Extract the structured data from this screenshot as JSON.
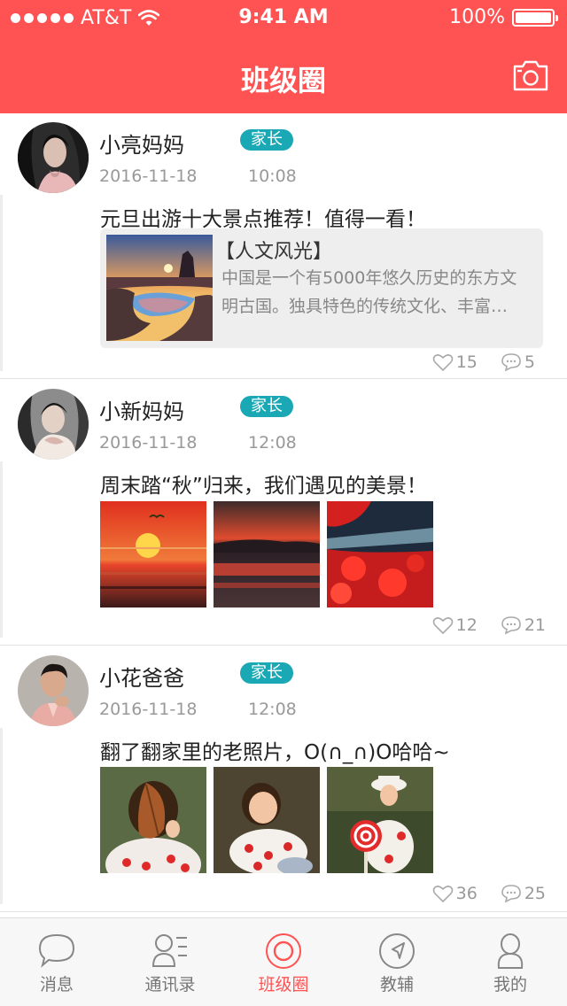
{
  "status_bar": {
    "carrier": "AT&T",
    "time": "9:41 AM",
    "battery": "100%"
  },
  "header": {
    "title": "班级圈"
  },
  "colors": {
    "accent": "#ff5353",
    "role_badge": "#1aa8b5"
  },
  "posts": [
    {
      "author": "小亮妈妈",
      "role": "家长",
      "date": "2016-11-18",
      "time": "10:08",
      "content": "元旦出游十大景点推荐！值得一看！",
      "share": {
        "title": "【人文风光】",
        "description": "中国是一个有5000年悠久历史的东方文明古国。独具特色的传统文化、丰富…"
      },
      "likes": "15",
      "comments": "5"
    },
    {
      "author": "小新妈妈",
      "role": "家长",
      "date": "2016-11-18",
      "time": "12:08",
      "content": "周末踏“秋”归来，我们遇见的美景！",
      "likes": "12",
      "comments": "21"
    },
    {
      "author": "小花爸爸",
      "role": "家长",
      "date": "2016-11-18",
      "time": "12:08",
      "content": "翻了翻家里的老照片，O(∩_∩)O哈哈~",
      "likes": "36",
      "comments": "25"
    }
  ],
  "tabbar": {
    "items": [
      {
        "label": "消息",
        "icon": "message-icon"
      },
      {
        "label": "通讯录",
        "icon": "contacts-icon"
      },
      {
        "label": "班级圈",
        "icon": "circle-icon",
        "active": true
      },
      {
        "label": "教辅",
        "icon": "compass-icon"
      },
      {
        "label": "我的",
        "icon": "profile-icon"
      }
    ]
  }
}
